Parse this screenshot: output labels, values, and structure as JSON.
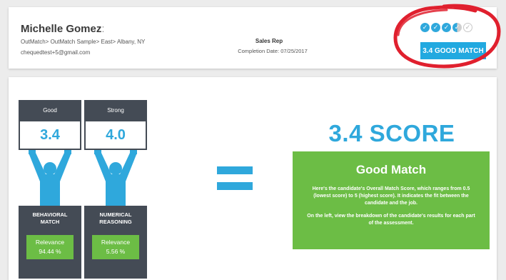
{
  "candidate": {
    "name": "Michelle Gomez",
    "path": "OutMatch> OutMatch Sample> East> Albany, NY",
    "email": "chequedtest+5@gmail.com"
  },
  "job": {
    "title": "Sales Rep",
    "completion": "Completion Date: 07/25/2017"
  },
  "rating": {
    "dots_filled": 3,
    "dots_half": 1,
    "dots_total": 5,
    "badge_label": "3.4 GOOD MATCH"
  },
  "columns": [
    {
      "header": "Good",
      "score": "3.4",
      "title_line1": "BEHAVIORAL",
      "title_line2": "MATCH",
      "relevance_label": "Relevance",
      "relevance_value": "94.44 %"
    },
    {
      "header": "Strong",
      "score": "4.0",
      "title_line1": "NUMERICAL",
      "title_line2": "REASONING",
      "relevance_label": "Relevance",
      "relevance_value": "5.56 %"
    }
  ],
  "summary": {
    "score_heading": "3.4 SCORE",
    "match_title": "Good Match",
    "text1": "Here's the candidate's Overall Match Score, which ranges from 0.5 (lowest score) to 5 (highest score). It indicates the fit between the candidate and the job.",
    "text2": "On the left, view the breakdown of the candidate's results for each part of the assessment."
  },
  "colors": {
    "accent_blue": "#2fa8dc",
    "green": "#6cbd45",
    "dark": "#444b55",
    "highlight_red": "#e0202e"
  },
  "icons": {
    "check": "check-icon",
    "person": "person-arms-up-icon",
    "equals": "equals-sign"
  }
}
